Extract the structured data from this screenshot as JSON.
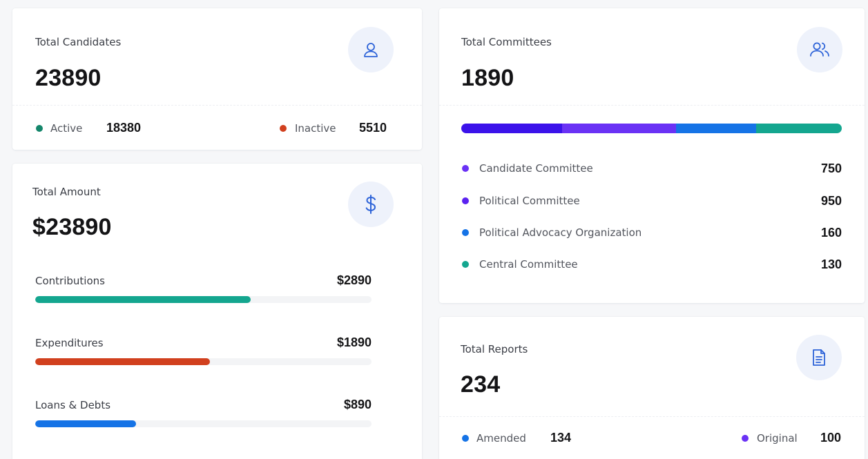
{
  "colors": {
    "green": "#14866b",
    "red": "#d1401e",
    "blue": "#1573e6",
    "purple": "#6a32f5",
    "indigo": "#3b12ea",
    "teal": "#14a68f"
  },
  "candidates": {
    "title": "Total Candidates",
    "value": "23890",
    "icon": "user-icon",
    "active_label": "Active",
    "active_value": "18380",
    "inactive_label": "Inactive",
    "inactive_value": "5510"
  },
  "amount": {
    "title": "Total Amount",
    "value": "$23890",
    "icon": "dollar-icon",
    "rows": [
      {
        "label": "Contributions",
        "value": "$2890",
        "fraction": 0.64,
        "color": "#14a68f"
      },
      {
        "label": "Expenditures",
        "value": "$1890",
        "fraction": 0.52,
        "color": "#d1401e"
      },
      {
        "label": "Loans & Debts",
        "value": "$890",
        "fraction": 0.3,
        "color": "#1573e6"
      }
    ]
  },
  "committees": {
    "title": "Total Committees",
    "value": "1890",
    "icon": "users-icon",
    "segments": [
      {
        "fraction": 0.265,
        "color": "#3b12ea"
      },
      {
        "fraction": 0.3,
        "color": "#6a32f5"
      },
      {
        "fraction": 0.21,
        "color": "#1573e6"
      },
      {
        "fraction": 0.225,
        "color": "#14a68f"
      }
    ],
    "items": [
      {
        "label": "Candidate Committee",
        "value": "750",
        "color": "#6a32f5"
      },
      {
        "label": "Political Committee",
        "value": "950",
        "color": "#5b22f0"
      },
      {
        "label": "Political Advocacy Organization",
        "value": "160",
        "color": "#1573e6"
      },
      {
        "label": "Central Committee",
        "value": "130",
        "color": "#14a68f"
      }
    ]
  },
  "reports": {
    "title": "Total Reports",
    "value": "234",
    "icon": "document-icon",
    "amended_label": "Amended",
    "amended_value": "134",
    "original_label": "Original",
    "original_value": "100"
  }
}
